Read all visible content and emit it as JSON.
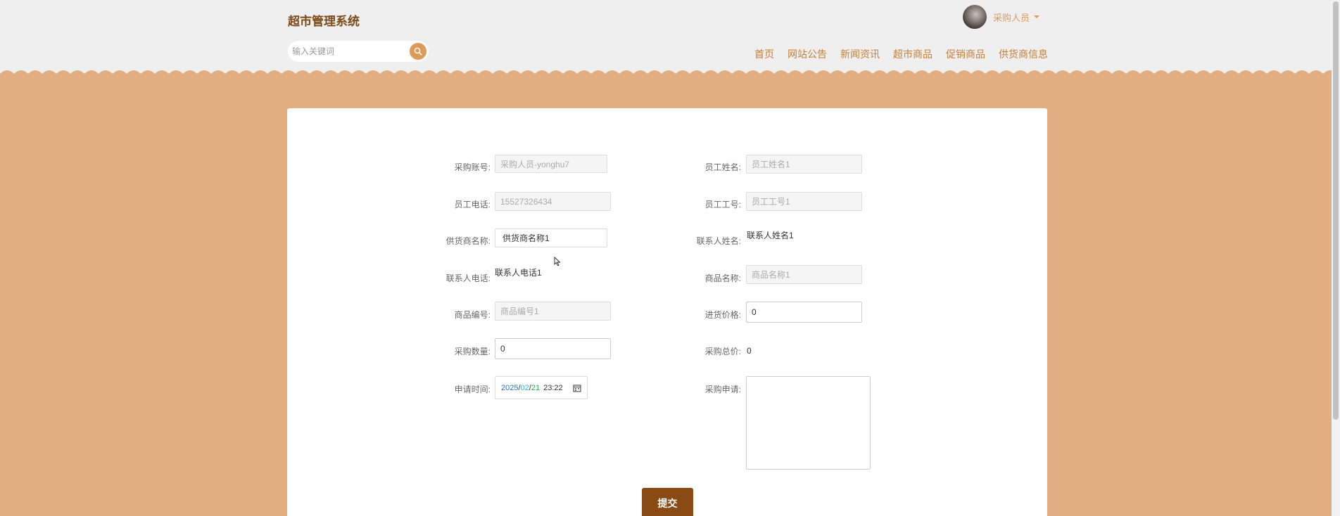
{
  "app": {
    "title": "超市管理系统"
  },
  "search": {
    "placeholder": "输入关键词"
  },
  "user": {
    "name": "采购人员"
  },
  "nav": {
    "items": [
      "首页",
      "网站公告",
      "新闻资讯",
      "超市商品",
      "促销商品",
      "供货商信息"
    ]
  },
  "form": {
    "caigouzhanghao": {
      "label": "采购账号:",
      "value": "采购人员-yonghu7"
    },
    "yuangongxingming": {
      "label": "员工姓名:",
      "value": "员工姓名1"
    },
    "yuangongdianhua": {
      "label": "员工电话:",
      "value": "15527326434"
    },
    "yuangonggonghao": {
      "label": "员工工号:",
      "value": "员工工号1"
    },
    "gonghuoshangmingcheng": {
      "label": "供货商名称:",
      "value": "供货商名称1"
    },
    "lianxirenxingming": {
      "label": "联系人姓名:",
      "value": "联系人姓名1"
    },
    "lianxirendianhua": {
      "label": "联系人电话:",
      "value": "联系人电话1"
    },
    "shangpinmingcheng": {
      "label": "商品名称:",
      "value": "商品名称1"
    },
    "shangpinbianhao": {
      "label": "商品编号:",
      "value": "商品编号1"
    },
    "jinhuojiage": {
      "label": "进货价格:",
      "value": "0"
    },
    "caigoushuliang": {
      "label": "采购数量:",
      "value": "0"
    },
    "caigouzongjia": {
      "label": "采购总价:",
      "value": "0"
    },
    "shenqingshijian": {
      "label": "申请时间:",
      "year": "2025",
      "month": "02",
      "day": "21",
      "separator": "/",
      "time": "23:22"
    },
    "caigoushenqing": {
      "label": "采购申请:",
      "value": ""
    },
    "submit_label": "提交"
  },
  "colors": {
    "brand": "#7b4a17",
    "accent": "#de9a58",
    "background": "#e2ad81",
    "header_bg": "#efefef",
    "submit_bg": "#8a4a14"
  },
  "icons": {
    "search": "search-icon",
    "dropdown": "chevron-down-icon",
    "calendar": "calendar-icon"
  }
}
